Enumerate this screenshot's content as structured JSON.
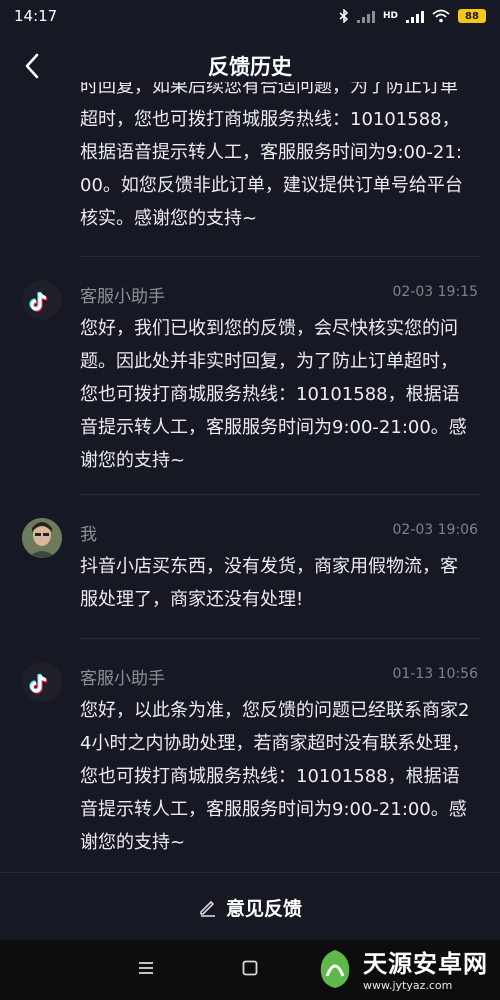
{
  "status_bar": {
    "time": "14:17",
    "battery": "88",
    "network": "HD"
  },
  "nav": {
    "title": "反馈历史"
  },
  "messages": [
    {
      "name": "",
      "time": "",
      "text": "时回复，如果后续您有合适问题，为了防止订单超时，您也可拨打商城服务热线：10101588，根据语音提示转人工，客服服务时间为9:00-21:00。如您反馈非此订单，建议提供订单号给平台核实。感谢您的支持~"
    },
    {
      "name": "客服小助手",
      "time": "02-03 19:15",
      "text": "您好，我们已收到您的反馈，会尽快核实您的问题。因此处并非实时回复，为了防止订单超时，您也可拨打商城服务热线：10101588，根据语音提示转人工，客服服务时间为9:00-21:00。感谢您的支持~"
    },
    {
      "name": "我",
      "time": "02-03 19:06",
      "text": "抖音小店买东西，没有发货，商家用假物流，客服处理了，商家还没有处理!"
    },
    {
      "name": "客服小助手",
      "time": "01-13 10:56",
      "text": "您好，以此条为准，您反馈的问题已经联系商家24小时之内协助处理，若商家超时没有联系处理，您也可拨打商城服务热线：10101588，根据语音提示转人工，客服服务时间为9:00-21:00。感谢您的支持~"
    }
  ],
  "feedback_button": {
    "label": "意见反馈"
  },
  "watermark": {
    "main": "天源安卓网",
    "url": "www.jytyaz.com"
  },
  "icons": {
    "back": "chevron-left-icon",
    "edit": "pencil-icon",
    "tiktok": "tiktok-logo-icon",
    "menu": "menu-icon",
    "home": "square-icon"
  },
  "colors": {
    "background": "#161823",
    "tiktok_cyan": "#25f4ee",
    "tiktok_red": "#fe2c55"
  }
}
